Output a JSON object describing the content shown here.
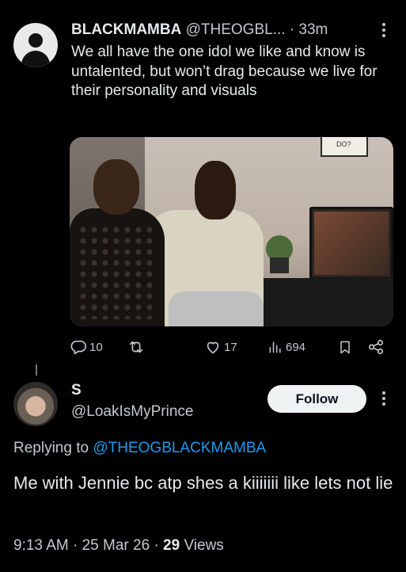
{
  "tweet": {
    "author_name": "BLACKMAMBA",
    "author_handle": "@THEOGBL...",
    "separator": "·",
    "time": "33m",
    "text": "We all have the one idol we like and know is untalented, but won’t drag because we live for their personality and visuals",
    "media": {
      "frame_text": "DO?"
    },
    "actions": {
      "replies": "10",
      "likes": "17",
      "views": "694"
    },
    "icons": [
      "reply-icon",
      "retweet-icon",
      "like-icon",
      "views-icon",
      "bookmark-icon",
      "share-icon",
      "more-icon"
    ]
  },
  "reply": {
    "author_name": "S",
    "author_handle": "@LoakIsMyPrince",
    "follow_label": "Follow",
    "replying_prefix": "Replying to",
    "replying_mention": "@THEOGBLACKMAMBA",
    "text": "Me with Jennie bc atp shes a kiiiiiii like lets not lie",
    "time": "9:13 AM",
    "date": "25 Mar 26",
    "views_count": "29",
    "views_label": "Views"
  },
  "colors": {
    "background": "#000000",
    "text_primary": "#e7e9ea",
    "text_secondary": "#c4c8cc",
    "link": "#1d9bf0",
    "follow_button": "#eff3f4"
  }
}
